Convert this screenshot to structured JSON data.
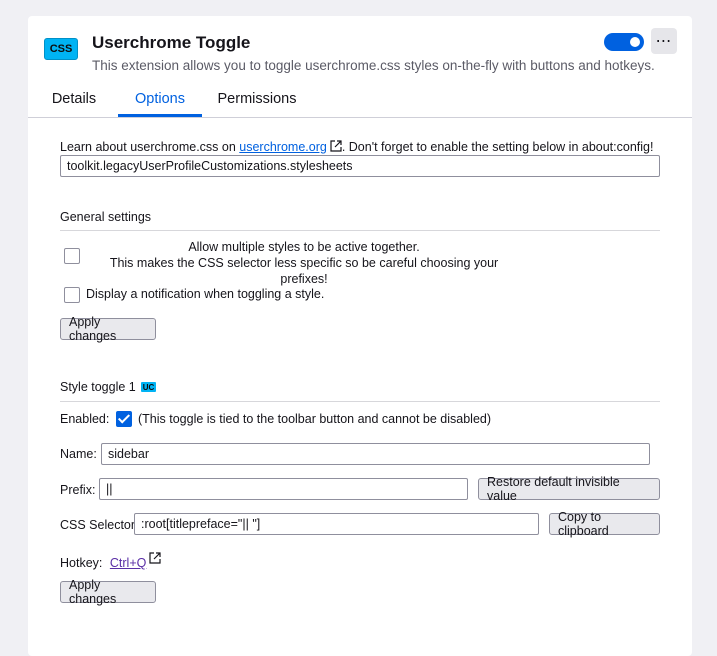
{
  "header": {
    "icon_label": "CSS",
    "title": "Userchrome Toggle",
    "description": "This extension allows you to toggle userchrome.css styles on-the-fly with buttons and hotkeys.",
    "enabled": true,
    "more_label": "⋯"
  },
  "tabs": [
    {
      "label": "Details",
      "active": false
    },
    {
      "label": "Options",
      "active": true
    },
    {
      "label": "Permissions",
      "active": false
    }
  ],
  "intro": {
    "text_before": "Learn about userchrome.css on ",
    "link_text": "userchrome.org",
    "text_after": ". Don't forget to enable the setting below in about:config!",
    "config_value": "toolkit.legacyUserProfileCustomizations.stylesheets"
  },
  "general": {
    "title": "General settings",
    "multi_line1": "Allow multiple styles to be active together.",
    "multi_line2": "This makes the CSS selector less specific so be careful choosing your prefixes!",
    "multi_checked": false,
    "notify_label": "Display a notification when toggling a style.",
    "notify_checked": false,
    "apply_label": "Apply changes"
  },
  "style_toggle": {
    "title": "Style toggle 1",
    "badge": "UC",
    "enabled_label": "Enabled:",
    "enabled_checked": true,
    "enabled_note": "(This toggle is tied to the toolbar button and cannot be disabled)",
    "name_label": "Name:",
    "name_value": "sidebar",
    "prefix_label": "Prefix:",
    "prefix_value": "||",
    "restore_label": "Restore default invisible value",
    "selector_label": "CSS Selector:",
    "selector_value": ":root[titlepreface=\"|| \"]",
    "copy_label": "Copy to clipboard",
    "hotkey_label": "Hotkey:",
    "hotkey_value": "Ctrl+Q",
    "apply_label": "Apply changes"
  },
  "colors": {
    "accent": "#0061e0",
    "badge": "#00b3f4",
    "background": "#f0f0f4"
  }
}
